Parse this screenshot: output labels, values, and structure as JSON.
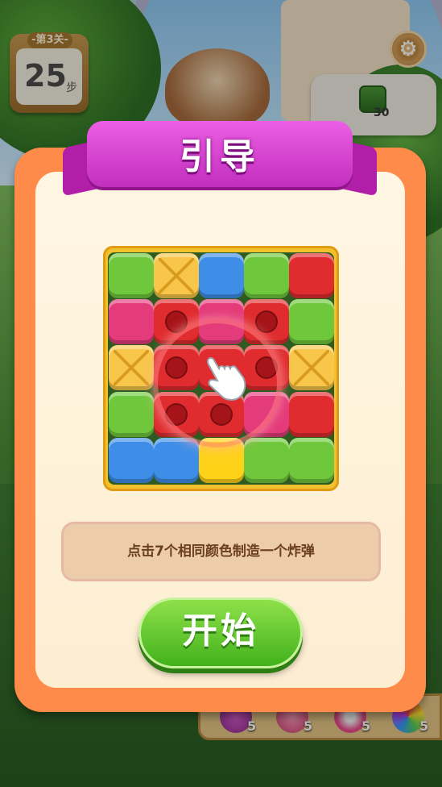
{
  "hud": {
    "level_label": "-第3关-",
    "moves": "25",
    "moves_unit": "步",
    "goal": {
      "icon": "green-block-icon",
      "count": "30"
    },
    "settings_icon": "gear-icon"
  },
  "dialog": {
    "title": "引导",
    "instruction": "点击7个相同颜色制造一个炸弹",
    "start_label": "开始",
    "board": {
      "rows": [
        [
          "green",
          "box",
          "blue",
          "green",
          "red"
        ],
        [
          "pink",
          "red-bomb",
          "pink",
          "red-bomb",
          "green"
        ],
        [
          "box",
          "red-bomb",
          "red",
          "red-bomb",
          "box"
        ],
        [
          "green",
          "red-bomb",
          "red-bomb",
          "pink",
          "red"
        ],
        [
          "blue",
          "blue",
          "yellow",
          "green",
          "green"
        ]
      ],
      "colors": {
        "green": "#6fc83c",
        "red": "#e02c2f",
        "blue": "#3e8ee8",
        "pink": "#e43b7a",
        "yellow": "#ffd21a",
        "box": "#f7c64a"
      }
    }
  },
  "boosters": [
    {
      "icon": "hammer-icon",
      "count": "5"
    },
    {
      "icon": "candy-ball-icon",
      "count": "5"
    },
    {
      "icon": "star-icon",
      "count": "5"
    },
    {
      "icon": "rainbow-ball-icon",
      "count": "5"
    }
  ]
}
